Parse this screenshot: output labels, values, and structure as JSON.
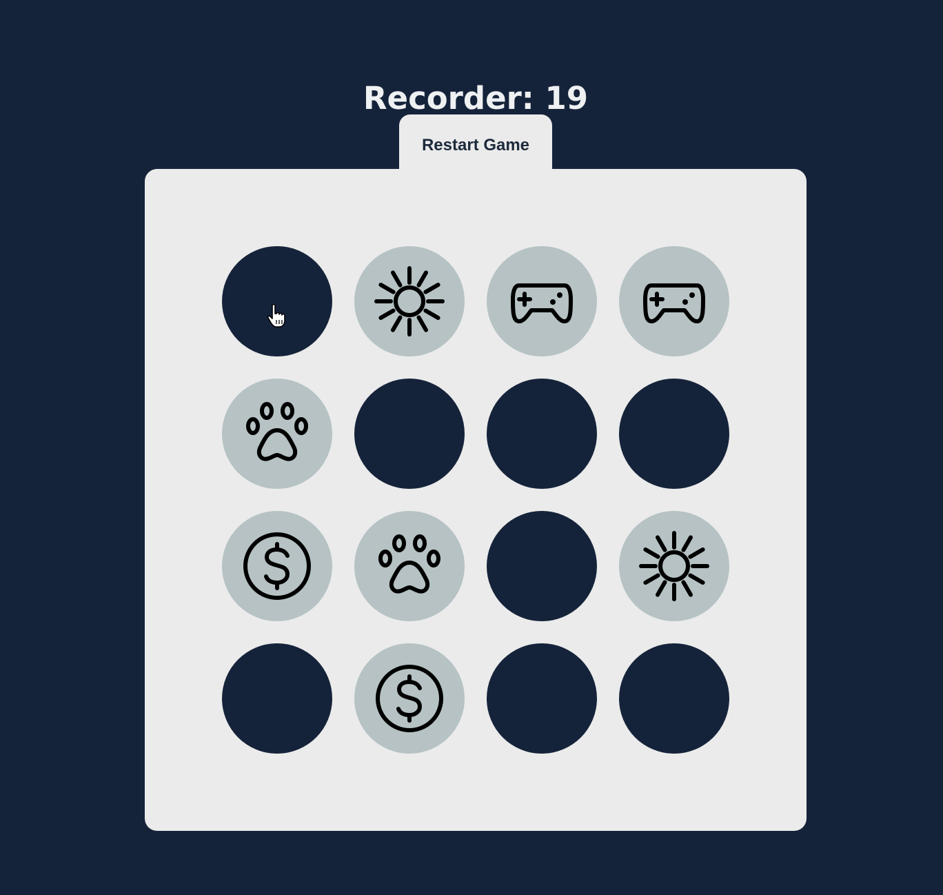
{
  "header": {
    "score_label": "Recorder: 19"
  },
  "controls": {
    "restart_label": "Restart Game"
  },
  "colors": {
    "background": "#15233a",
    "board": "#ebebeb",
    "tile_hidden": "#15233a",
    "tile_revealed": "#b6c2c4",
    "icon_stroke": "#000000"
  },
  "board": {
    "rows": 4,
    "columns": 4,
    "tiles": [
      {
        "state": "hidden",
        "icon": null
      },
      {
        "state": "revealed",
        "icon": "sun-icon"
      },
      {
        "state": "revealed",
        "icon": "gamepad-icon"
      },
      {
        "state": "revealed",
        "icon": "gamepad-icon"
      },
      {
        "state": "revealed",
        "icon": "paw-icon"
      },
      {
        "state": "hidden",
        "icon": null
      },
      {
        "state": "hidden",
        "icon": null
      },
      {
        "state": "hidden",
        "icon": null
      },
      {
        "state": "revealed",
        "icon": "dollar-coin-icon"
      },
      {
        "state": "revealed",
        "icon": "paw-icon"
      },
      {
        "state": "hidden",
        "icon": null
      },
      {
        "state": "revealed",
        "icon": "sun-icon"
      },
      {
        "state": "hidden",
        "icon": null
      },
      {
        "state": "revealed",
        "icon": "dollar-coin-icon"
      },
      {
        "state": "hidden",
        "icon": null
      },
      {
        "state": "hidden",
        "icon": null
      }
    ]
  },
  "pointer": {
    "icon": "hand-pointer-icon"
  }
}
